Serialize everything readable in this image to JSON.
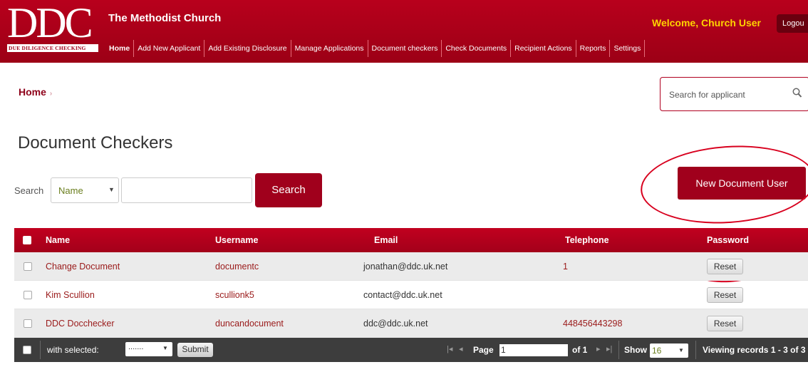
{
  "header": {
    "logo_text": "DDC",
    "logo_tagline": "DUE DILIGENCE CHECKING",
    "org_name": "The Methodist Church",
    "welcome": "Welcome, Church User",
    "logout": "Logou",
    "nav": [
      "Home",
      "Add New Applicant",
      "Add Existing Disclosure",
      "Manage Applications",
      "Document checkers",
      "Check Documents",
      "Recipient Actions",
      "Reports",
      "Settings"
    ]
  },
  "breadcrumb": {
    "home": "Home",
    "separator": "›"
  },
  "applicant_search": {
    "placeholder": "Search for applicant"
  },
  "page_title": "Document Checkers",
  "filter": {
    "label": "Search",
    "field_value": "Name",
    "query_value": "",
    "search_button": "Search"
  },
  "new_user_button": "New Document User",
  "table": {
    "columns": [
      "Name",
      "Username",
      "Email",
      "Telephone",
      "Password"
    ],
    "rows": [
      {
        "name": "Change Document",
        "username": "documentc",
        "email": "jonathan@ddc.uk.net",
        "telephone": "1",
        "action": "Reset"
      },
      {
        "name": "Kim Scullion",
        "username": "scullionk5",
        "email": "contact@ddc.uk.net",
        "telephone": "",
        "action": "Reset"
      },
      {
        "name": "DDC Docchecker",
        "username": "duncandocument",
        "email": "ddc@ddc.uk.net",
        "telephone": "448456443298",
        "action": "Reset"
      }
    ]
  },
  "footer": {
    "with_selected": "with selected:",
    "bulk_select_value": ".......",
    "submit": "Submit",
    "page_label": "Page",
    "page_value": "1",
    "of_label": "of 1",
    "show_label": "Show",
    "show_value": "16",
    "viewing": "Viewing records 1 - 3 of 3"
  },
  "colors": {
    "brand_red": "#a0001c",
    "welcome_yellow": "#ffd400",
    "annotation_red": "#d8001e"
  }
}
